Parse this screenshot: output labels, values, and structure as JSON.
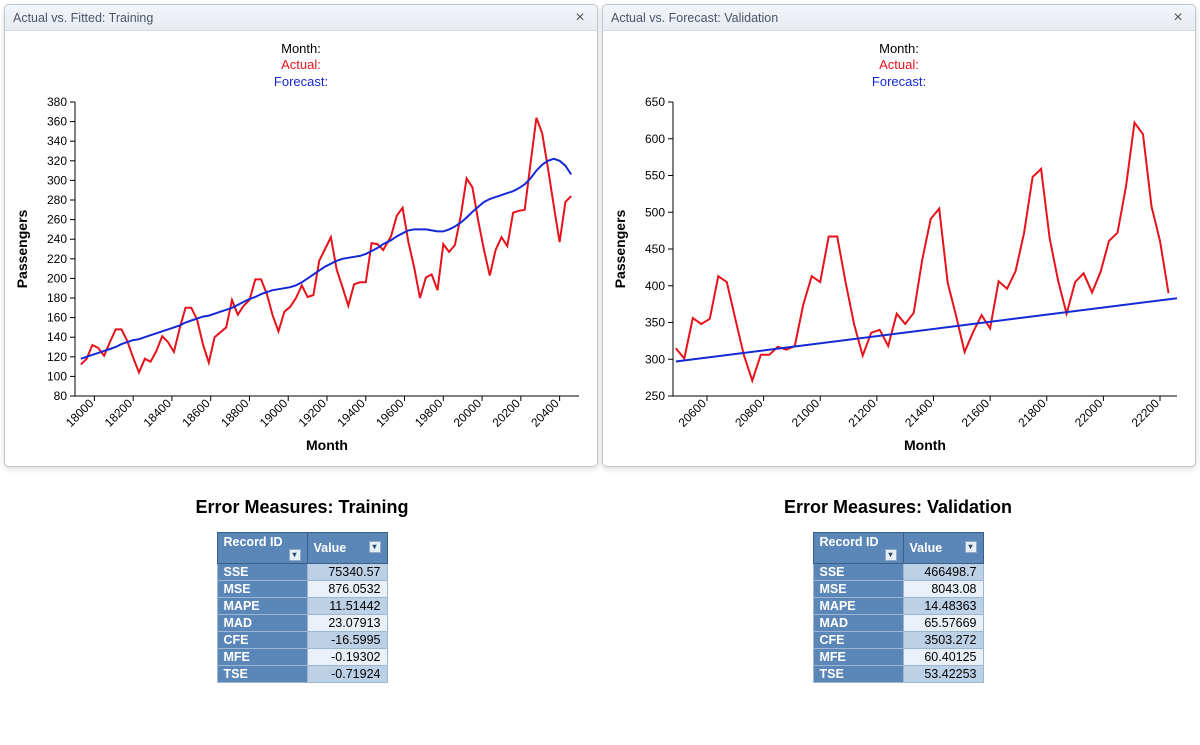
{
  "panel_left": {
    "title": "Actual vs. Fitted: Training",
    "legend": {
      "month": "Month:",
      "actual": "Actual:",
      "forecast": "Forecast:"
    },
    "xlabel": "Month",
    "ylabel": "Passengers"
  },
  "panel_right": {
    "title": "Actual vs. Forecast: Validation",
    "legend": {
      "month": "Month:",
      "actual": "Actual:",
      "forecast": "Forecast:"
    },
    "xlabel": "Month",
    "ylabel": "Passengers"
  },
  "metrics_left": {
    "title": "Error Measures: Training",
    "headers": [
      "Record ID",
      "Value"
    ],
    "rows": [
      [
        "SSE",
        "75340.57"
      ],
      [
        "MSE",
        "876.0532"
      ],
      [
        "MAPE",
        "11.51442"
      ],
      [
        "MAD",
        "23.07913"
      ],
      [
        "CFE",
        "-16.5995"
      ],
      [
        "MFE",
        "-0.19302"
      ],
      [
        "TSE",
        "-0.71924"
      ]
    ]
  },
  "metrics_right": {
    "title": "Error Measures: Validation",
    "headers": [
      "Record ID",
      "Value"
    ],
    "rows": [
      [
        "SSE",
        "466498.7"
      ],
      [
        "MSE",
        "8043.08"
      ],
      [
        "MAPE",
        "14.48363"
      ],
      [
        "MAD",
        "65.57669"
      ],
      [
        "CFE",
        "3503.272"
      ],
      [
        "MFE",
        "60.40125"
      ],
      [
        "TSE",
        "53.42253"
      ]
    ]
  },
  "chart_data": [
    {
      "id": "training",
      "type": "line",
      "title": "Actual vs. Fitted: Training",
      "xlabel": "Month",
      "ylabel": "Passengers",
      "xlim": [
        17900,
        20500
      ],
      "ylim": [
        80,
        380
      ],
      "yticks": [
        80,
        100,
        120,
        140,
        160,
        180,
        200,
        220,
        240,
        260,
        280,
        300,
        320,
        340,
        360,
        380
      ],
      "xticks": [
        18000,
        18200,
        18400,
        18600,
        18800,
        19000,
        19200,
        19400,
        19600,
        19800,
        20000,
        20200,
        20400
      ],
      "series": [
        {
          "name": "Actual",
          "color": "#e8121a",
          "x": [
            17930,
            17960,
            17990,
            18020,
            18050,
            18080,
            18110,
            18140,
            18170,
            18200,
            18230,
            18260,
            18290,
            18320,
            18350,
            18380,
            18410,
            18440,
            18470,
            18500,
            18530,
            18560,
            18590,
            18620,
            18650,
            18680,
            18710,
            18740,
            18770,
            18800,
            18830,
            18860,
            18890,
            18920,
            18950,
            18980,
            19010,
            19040,
            19070,
            19100,
            19130,
            19160,
            19190,
            19220,
            19250,
            19280,
            19310,
            19340,
            19370,
            19400,
            19430,
            19460,
            19490,
            19530,
            19560,
            19590,
            19620,
            19650,
            19680,
            19710,
            19740,
            19770,
            19800,
            19830,
            19860,
            19890,
            19920,
            19950,
            19980,
            20010,
            20040,
            20070,
            20100,
            20130,
            20160,
            20190,
            20220,
            20250,
            20280,
            20310,
            20340,
            20370,
            20400,
            20430,
            20460
          ],
          "y": [
            112,
            118,
            132,
            129,
            121,
            135,
            148,
            148,
            136,
            119,
            104,
            118,
            115,
            126,
            141,
            135,
            125,
            149,
            170,
            170,
            158,
            133,
            114,
            140,
            145,
            150,
            178,
            163,
            172,
            178,
            199,
            199,
            184,
            162,
            146,
            166,
            171,
            180,
            193,
            181,
            183,
            218,
            230,
            242,
            209,
            191,
            172,
            194,
            196,
            196,
            236,
            235,
            229,
            243,
            264,
            272,
            237,
            211,
            180,
            201,
            204,
            188,
            235,
            227,
            234,
            264,
            302,
            293,
            259,
            229,
            203,
            229,
            242,
            233,
            267,
            269,
            270,
            317,
            364,
            348,
            312,
            274,
            237,
            278,
            284
          ]
        },
        {
          "name": "Forecast",
          "color": "#1429d6",
          "x": [
            17930,
            17960,
            17990,
            18020,
            18050,
            18080,
            18110,
            18140,
            18170,
            18200,
            18230,
            18260,
            18290,
            18320,
            18350,
            18380,
            18410,
            18440,
            18470,
            18500,
            18530,
            18560,
            18590,
            18620,
            18650,
            18680,
            18710,
            18740,
            18770,
            18800,
            18830,
            18860,
            18890,
            18920,
            18950,
            18980,
            19010,
            19040,
            19070,
            19100,
            19130,
            19160,
            19190,
            19220,
            19250,
            19280,
            19310,
            19340,
            19370,
            19400,
            19430,
            19460,
            19490,
            19530,
            19560,
            19590,
            19620,
            19650,
            19680,
            19710,
            19740,
            19770,
            19800,
            19830,
            19860,
            19890,
            19920,
            19950,
            19980,
            20010,
            20040,
            20070,
            20100,
            20130,
            20160,
            20190,
            20220,
            20250,
            20280,
            20310,
            20340,
            20370,
            20400,
            20430,
            20460
          ],
          "y": [
            118,
            120,
            122,
            124,
            126,
            128,
            130,
            133,
            135,
            137,
            138,
            140,
            142,
            144,
            146,
            148,
            150,
            152,
            155,
            157,
            159,
            161,
            162,
            164,
            166,
            168,
            170,
            173,
            176,
            179,
            181,
            184,
            186,
            188,
            189,
            190,
            191,
            193,
            196,
            200,
            204,
            208,
            212,
            215,
            218,
            220,
            221,
            222,
            223,
            225,
            228,
            231,
            235,
            239,
            243,
            246,
            249,
            250,
            250,
            250,
            249,
            248,
            248,
            250,
            253,
            257,
            262,
            268,
            273,
            278,
            281,
            283,
            285,
            287,
            289,
            292,
            296,
            302,
            310,
            316,
            320,
            322,
            320,
            315,
            306
          ]
        }
      ]
    },
    {
      "id": "validation",
      "type": "line",
      "title": "Actual vs. Forecast: Validation",
      "xlabel": "Month",
      "ylabel": "Passengers",
      "xlim": [
        20480,
        22260
      ],
      "ylim": [
        250,
        650
      ],
      "yticks": [
        250,
        300,
        350,
        400,
        450,
        500,
        550,
        600,
        650
      ],
      "xticks": [
        20600,
        20800,
        21000,
        21200,
        21400,
        21600,
        21800,
        22000,
        22200
      ],
      "series": [
        {
          "name": "Actual",
          "color": "#e8121a",
          "x": [
            20490,
            20520,
            20550,
            20580,
            20610,
            20640,
            20670,
            20700,
            20730,
            20760,
            20790,
            20820,
            20850,
            20880,
            20910,
            20940,
            20970,
            21000,
            21030,
            21060,
            21090,
            21120,
            21150,
            21180,
            21210,
            21240,
            21270,
            21300,
            21330,
            21360,
            21390,
            21420,
            21450,
            21480,
            21510,
            21540,
            21570,
            21600,
            21630,
            21660,
            21690,
            21720,
            21750,
            21780,
            21810,
            21840,
            21870,
            21900,
            21930,
            21960,
            21990,
            22020,
            22050,
            22080,
            22110,
            22140,
            22170,
            22200,
            22230
          ],
          "y": [
            315,
            301,
            356,
            348,
            355,
            413,
            405,
            355,
            306,
            271,
            306,
            306,
            317,
            313,
            318,
            374,
            413,
            405,
            467,
            467,
            404,
            347,
            305,
            336,
            340,
            318,
            362,
            348,
            363,
            435,
            491,
            505,
            404,
            359,
            310,
            337,
            360,
            342,
            406,
            396,
            420,
            472,
            548,
            559,
            465,
            407,
            362,
            405,
            417,
            391,
            419,
            461,
            472,
            535,
            622,
            606,
            508,
            461,
            390
          ]
        },
        {
          "name": "Forecast",
          "color": "#1429d6",
          "x": [
            20490,
            22260
          ],
          "y": [
            297,
            383
          ]
        }
      ]
    }
  ]
}
